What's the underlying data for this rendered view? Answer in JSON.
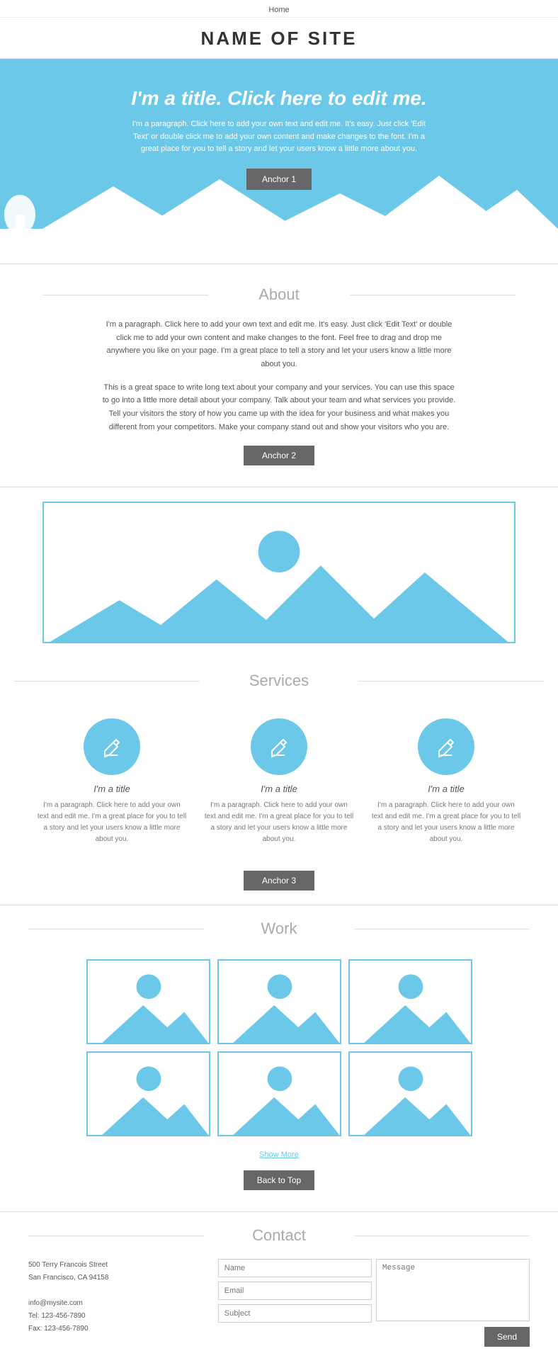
{
  "nav": {
    "home": "Home"
  },
  "site": {
    "title": "NAME OF SITE"
  },
  "hero": {
    "title": "I'm a title. Click here to edit me.",
    "text": "I'm a paragraph. Click here to add your own text and edit me. It's easy. Just click 'Edit Text' or double click me to add your own content and make changes to the font. I'm a great place for you to tell a story and let your users know a little more about you.",
    "anchor_btn": "Anchor 1"
  },
  "about": {
    "section_title": "About",
    "para1": "I'm a paragraph. Click here to add your own text and edit me. It's easy. Just click 'Edit Text' or double click me to add your own content and make changes to the font. Feel free to drag and drop me anywhere you like on your page. I'm a great place to tell a story and let your users know a little more about you.",
    "para2": "This is a great space to write long text about your company and your services. You can use this space to go into a little more detail about your company. Talk about your team and what services you provide. Tell your visitors the story of how you came up with the idea for your business and what makes you different from your competitors. Make your company stand out and show your visitors who you are.",
    "anchor_btn": "Anchor 2"
  },
  "services": {
    "section_title": "Services",
    "items": [
      {
        "title": "I'm a title",
        "text": "I'm a paragraph. Click here to add your own text and edit me. I'm a great place for you to tell a story and let your users know a little more about you."
      },
      {
        "title": "I'm a title",
        "text": "I'm a paragraph. Click here to add your own text and edit me. I'm a great place for you to tell a story and let your users know a little more about you."
      },
      {
        "title": "I'm a title",
        "text": "I'm a paragraph. Click here to add your own text and edit me. I'm a great place for you to tell a story and let your users know a little more about you."
      }
    ],
    "anchor_btn": "Anchor 3"
  },
  "work": {
    "section_title": "Work",
    "show_more": "Show More",
    "back_top_btn": "Back to Top"
  },
  "contact": {
    "section_title": "Contact",
    "address_line1": "500 Terry Francois Street",
    "address_line2": "San Francisco, CA 94158",
    "email": "info@mysite.com",
    "tel": "Tel: 123-456-7890",
    "fax": "Fax: 123-456-7890",
    "name_placeholder": "Name",
    "email_placeholder": "Email",
    "subject_placeholder": "Subject",
    "message_placeholder": "Message",
    "submit_btn": "Send"
  }
}
